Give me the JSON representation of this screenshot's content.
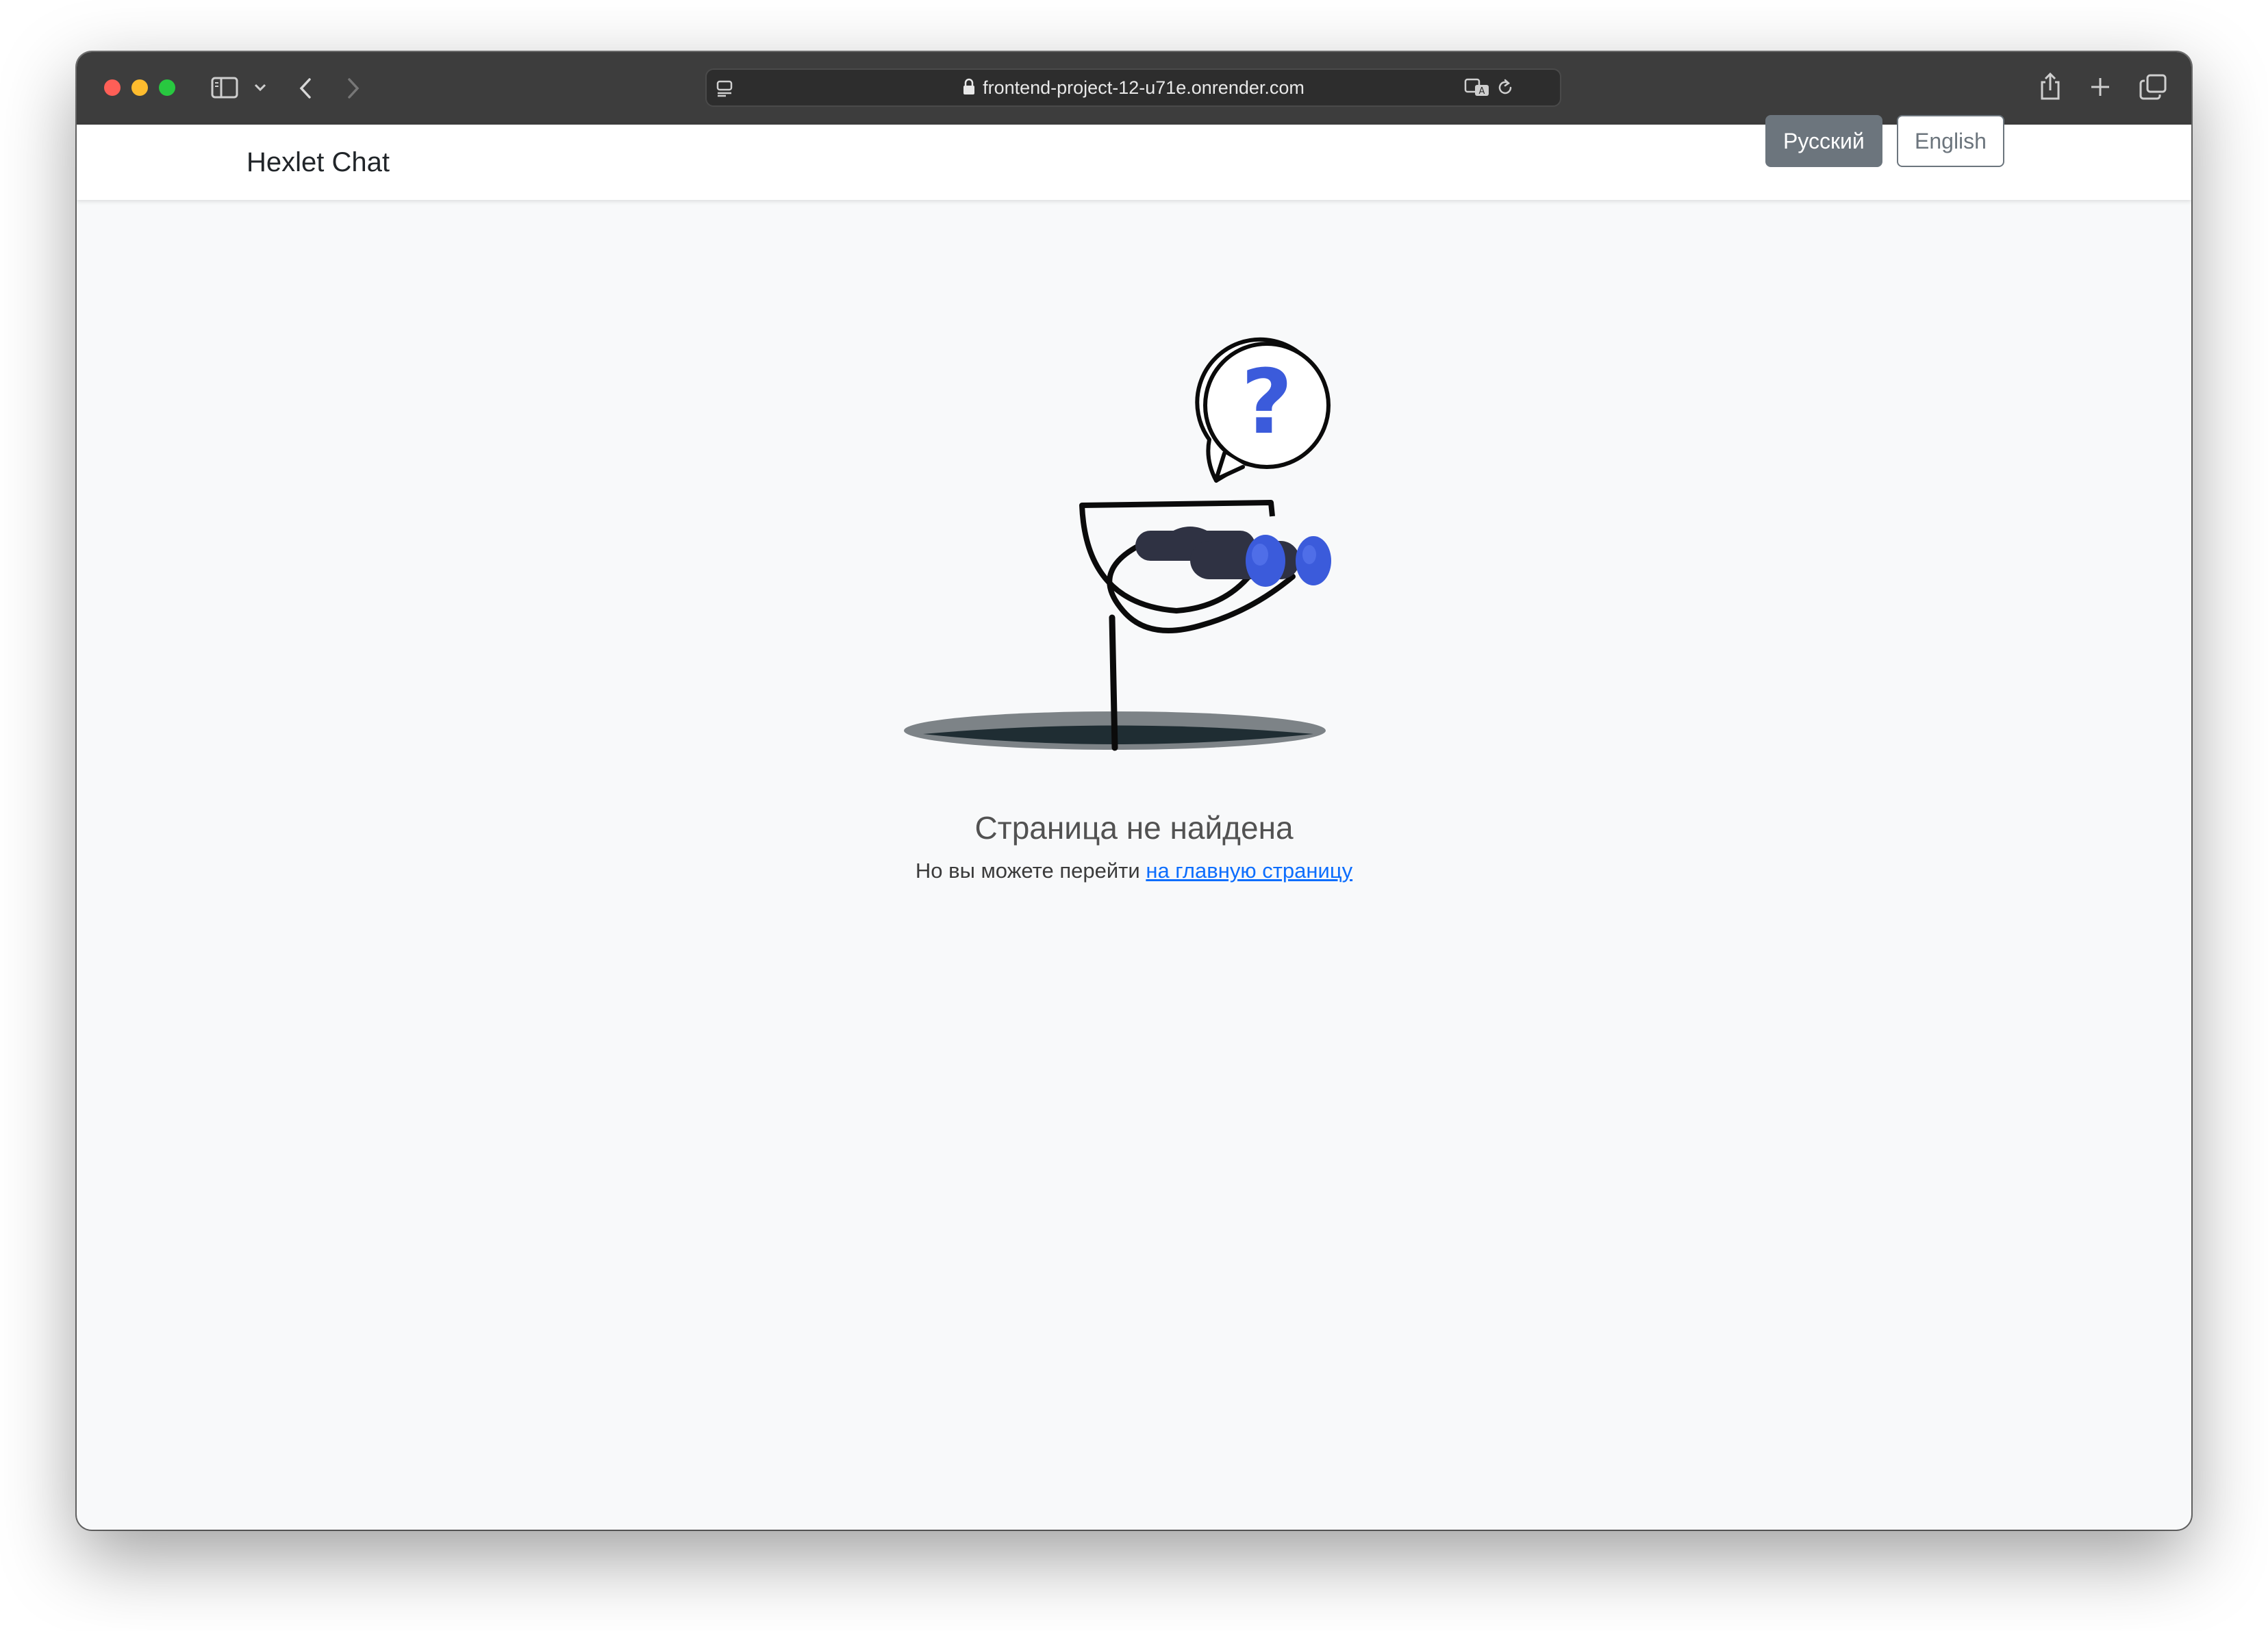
{
  "browser": {
    "url": "frontend-project-12-u71e.onrender.com"
  },
  "navbar": {
    "brand": "Hexlet Chat",
    "lang_ru": "Русский",
    "lang_en": "English"
  },
  "not_found": {
    "title": "Страница не найдена",
    "hint": "Но вы можете перейти",
    "link": "на главную страницу"
  },
  "colors": {
    "accent": "#3b5bdb",
    "lang_active_bg": "#6c757d",
    "link": "#0d6efd"
  }
}
